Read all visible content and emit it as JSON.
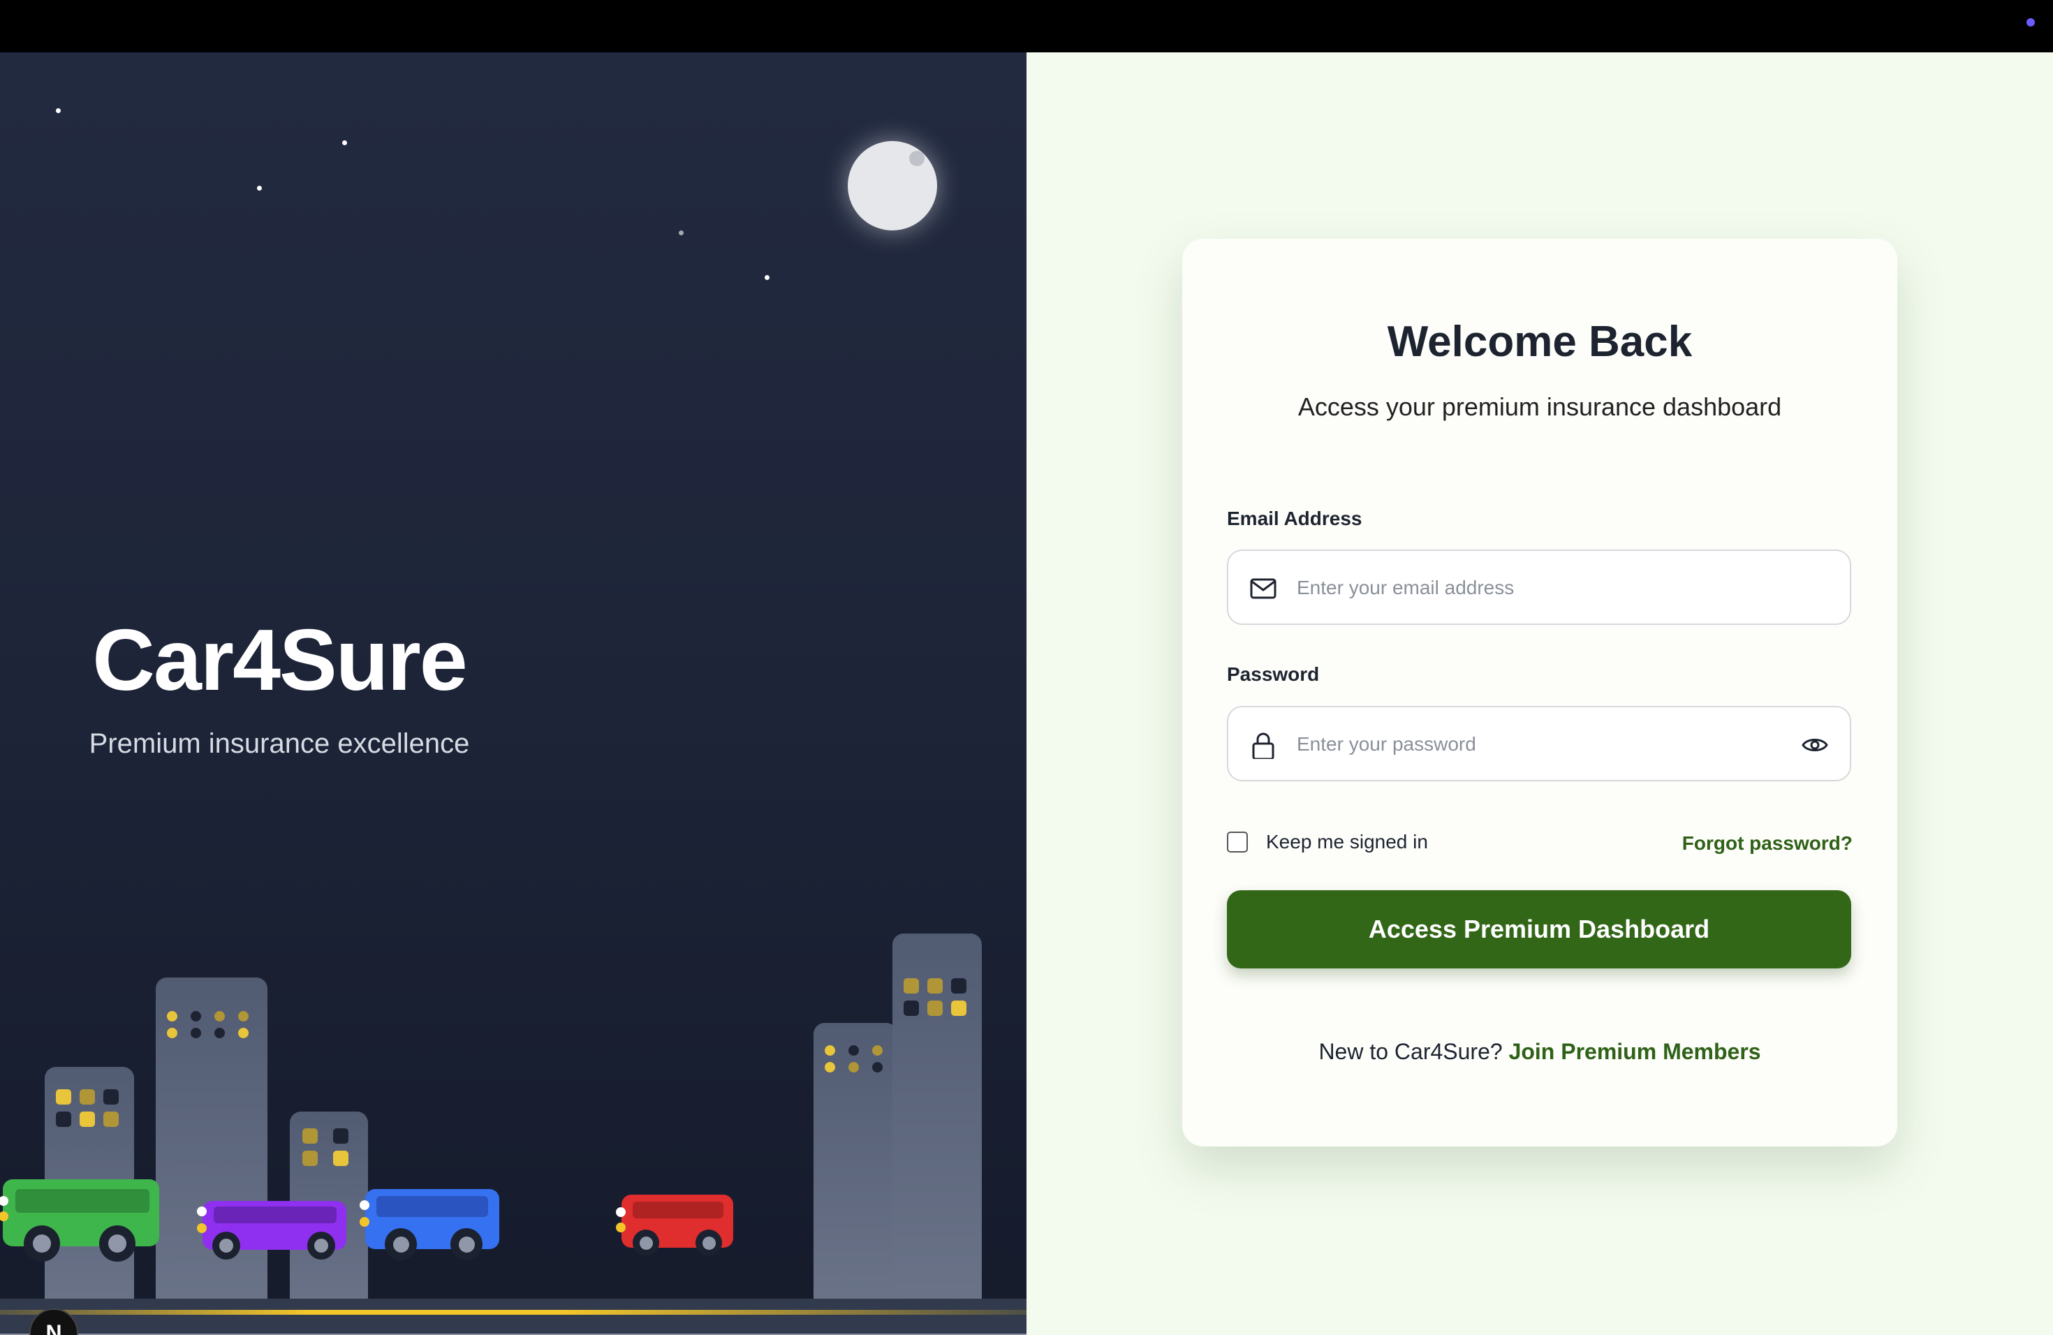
{
  "brand": {
    "name": "Car4Sure",
    "tagline": "Premium insurance excellence"
  },
  "login": {
    "title": "Welcome Back",
    "subtitle": "Access your premium insurance dashboard",
    "email": {
      "label": "Email Address",
      "placeholder": "Enter your email address",
      "value": ""
    },
    "password": {
      "label": "Password",
      "placeholder": "Enter your password",
      "value": ""
    },
    "remember_label": "Keep me signed in",
    "remember_checked": false,
    "forgot_label": "Forgot password?",
    "submit_label": "Access Premium Dashboard",
    "signup_prompt": "New to Car4Sure?",
    "signup_link": "Join Premium Members"
  },
  "dev_badge": {
    "label": "N"
  },
  "colors": {
    "primary_green": "#326718",
    "link_green": "#2f6117",
    "night_sky": "#1e2539",
    "panel_bg": "#f3fbee"
  },
  "icons": [
    "mail-icon",
    "lock-icon",
    "eye-icon",
    "moon-icon"
  ]
}
